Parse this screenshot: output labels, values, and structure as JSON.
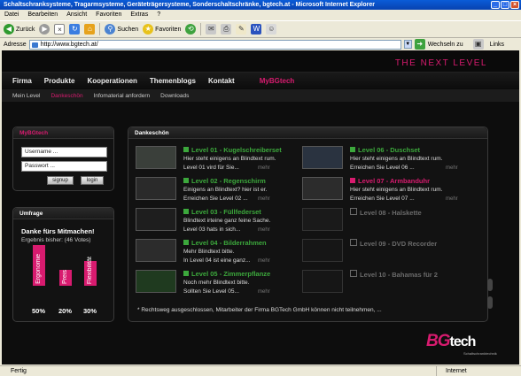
{
  "window": {
    "title": "Schaltschranksysteme, Tragarmsysteme, Geräteträgersysteme, Sonderschaltschränke, bgtech.at - Microsoft Internet Explorer"
  },
  "menu": [
    "Datei",
    "Bearbeiten",
    "Ansicht",
    "Favoriten",
    "Extras",
    "?"
  ],
  "toolbar": {
    "back": "Zurück",
    "search": "Suchen",
    "favorites": "Favoriten",
    "links": "Links"
  },
  "address": {
    "label": "Adresse",
    "url": "http://www.bgtech.at/",
    "go": "Wechseln zu"
  },
  "site": {
    "tagline": "THE NEXT LEVEL",
    "nav": [
      "Firma",
      "Produkte",
      "Kooperationen",
      "Themenblogs",
      "Kontakt"
    ],
    "nav_accent": "MyBGtech",
    "subnav": [
      "Mein Level",
      "Dankeschön",
      "Infomaterial anfordern",
      "Downloads"
    ],
    "login": {
      "heading": "MyBGtech",
      "username": "Username ...",
      "password": "Passwort ...",
      "signup": "signup",
      "login": "login"
    },
    "poll": {
      "heading": "Umfrage",
      "question": "Danke fürs Mitmachen!",
      "result": "Ergebnis bisher: (46 Votes)",
      "bars": [
        {
          "label": "Ergonomie",
          "value": 50,
          "pct": "50%"
        },
        {
          "label": "Preis",
          "value": 20,
          "pct": "20%"
        },
        {
          "label": "Flexibilität",
          "value": 30,
          "pct": "30%"
        }
      ]
    },
    "thanks": {
      "heading": "Dankeschön",
      "more": "mehr",
      "left": [
        {
          "title": "Level 01 - Kugelschreiberset",
          "line1": "Hier steht einigens an Blindtext rum.",
          "line2": "Level 01 vird für Sie...",
          "state": "green"
        },
        {
          "title": "Level 02 - Regenschirm",
          "line1": "Einigens an Blindtext? hier ist er.",
          "line2": "Erreichen Sie Level 02 ...",
          "state": "green"
        },
        {
          "title": "Level 03 - Füllfederset",
          "line1": "Blindtext irteine ganz feine Sache.",
          "line2": "Level 03 hats in sich...",
          "state": "green"
        },
        {
          "title": "Level 04 - Bilderrahmen",
          "line1": "Mehr Blindtext bitte.",
          "line2": "In Level 04 ist eine ganz...",
          "state": "green"
        },
        {
          "title": "Level 05 - Zimmerpflanze",
          "line1": "Noch mehr Blindtext bitte.",
          "line2": "Sollten Sie Level 05...",
          "state": "green"
        }
      ],
      "right": [
        {
          "title": "Level 06 - Duschset",
          "line1": "Hier steht einigens an Blindtext rum.",
          "line2": "Erreichen Sie Level 06 ...",
          "state": "green"
        },
        {
          "title": "Level 07 - Armbanduhr",
          "line1": "Hier steht einigens an Blindtext rum.",
          "line2": "Erreichen Sie Level 07 ...",
          "state": "pink"
        },
        {
          "title": "Level 08 - Halskette",
          "line1": "",
          "line2": "",
          "state": "grey"
        },
        {
          "title": "Level 09 - DVD Recorder",
          "line1": "",
          "line2": "",
          "state": "grey"
        },
        {
          "title": "Level 10 - Bahamas für 2",
          "line1": "",
          "line2": "",
          "state": "grey"
        }
      ],
      "footnote": "* Rechtsweg ausgeschlossen, Mitarbeiter der Firma BGTech GmbH können nicht teilnehmen, ..."
    },
    "logo": {
      "bg": "BG",
      "tech": "tech",
      "sub": "Schaltschranktechnik"
    }
  },
  "status": {
    "left": "Fertig",
    "right": "Internet"
  }
}
